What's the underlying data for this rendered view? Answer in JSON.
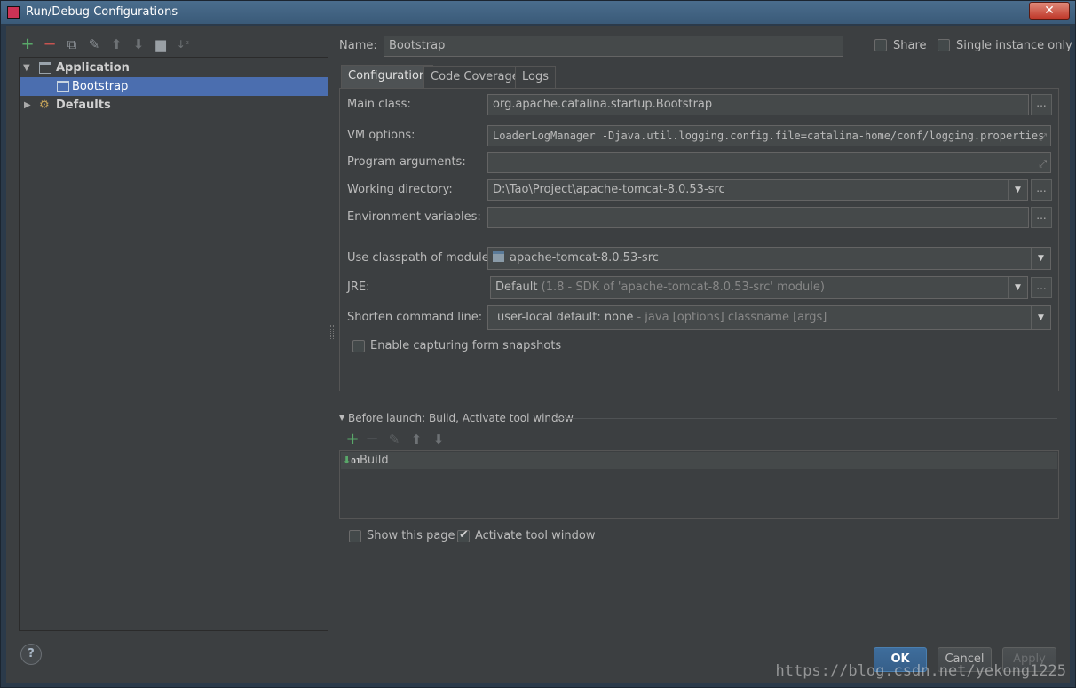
{
  "window": {
    "title": "Run/Debug Configurations",
    "close_glyph": "✕"
  },
  "left_toolbar": {
    "icons": [
      "add-icon",
      "remove-icon",
      "copy-icon",
      "wrench-icon",
      "move-up-icon",
      "move-down-icon",
      "folder-icon",
      "sort-icon"
    ]
  },
  "tree": {
    "items": [
      {
        "label": "Application",
        "expanded": true,
        "level": 0,
        "bold": true
      },
      {
        "label": "Bootstrap",
        "level": 1,
        "selected": true
      },
      {
        "label": "Defaults",
        "expanded": false,
        "level": 0,
        "bold": true
      }
    ]
  },
  "header": {
    "name_label": "Name:",
    "name_value": "Bootstrap",
    "share_label": "Share",
    "share_checked": false,
    "single_instance_label": "Single instance only",
    "single_instance_checked": false
  },
  "tabs": [
    {
      "label": "Configuration",
      "active": true
    },
    {
      "label": "Code Coverage",
      "active": false
    },
    {
      "label": "Logs",
      "active": false
    }
  ],
  "config": {
    "main_class_label": "Main class:",
    "main_class_value": "org.apache.catalina.startup.Bootstrap",
    "vm_options_label": "VM options:",
    "vm_options_value": "LoaderLogManager -Djava.util.logging.config.file=catalina-home/conf/logging.properties",
    "program_args_label": "Program arguments:",
    "program_args_value": "",
    "working_dir_label": "Working directory:",
    "working_dir_value": "D:\\Tao\\Project\\apache-tomcat-8.0.53-src",
    "env_vars_label": "Environment variables:",
    "env_vars_value": "",
    "classpath_label": "Use classpath of module:",
    "classpath_value": "apache-tomcat-8.0.53-src",
    "jre_label": "JRE:",
    "jre_value": "Default",
    "jre_hint": "(1.8 - SDK of 'apache-tomcat-8.0.53-src' module)",
    "shorten_label": "Shorten command line:",
    "shorten_value": "user-local default: none",
    "shorten_hint": "- java [options] classname [args]",
    "capture_label": "Enable capturing form snapshots",
    "capture_checked": false,
    "ellipsis": "..."
  },
  "before_launch": {
    "title": "Before launch: Build, Activate tool window",
    "items": [
      {
        "label": "Build"
      }
    ]
  },
  "footer": {
    "show_page_label": "Show this page",
    "show_page_checked": false,
    "activate_label": "Activate tool window",
    "activate_checked": true,
    "ok_label": "OK",
    "cancel_label": "Cancel",
    "apply_label": "Apply",
    "help_label": "?"
  },
  "watermark": "https://blog.csdn.net/yekong1225",
  "colors": {
    "selection": "#4b6eaf",
    "add_green": "#59a869",
    "remove_red": "#c75450",
    "primary_button": "#365f89"
  }
}
